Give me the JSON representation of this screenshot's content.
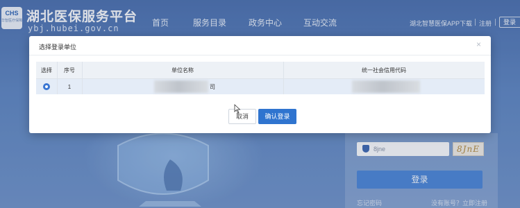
{
  "header": {
    "logo_text": "CHS",
    "logo_sub": "华智医疗保障",
    "site_title": "湖北医保服务平台",
    "site_domain": "ybj.hubei.gov.cn",
    "nav": [
      "首页",
      "服务目录",
      "政务中心",
      "互动交流"
    ],
    "app_download": "湖北智慧医保APP下载",
    "register": "注册",
    "login": "登录"
  },
  "login_form": {
    "captcha_value": "8jne",
    "captcha_image_text": "8JnE",
    "login_button": "登录",
    "forgot_password": "忘记密码",
    "register_prompt": "没有账号？立即注册"
  },
  "modal": {
    "title": "选择登录单位",
    "close_icon": "close-icon",
    "columns": [
      "选择",
      "序号",
      "单位名称",
      "统一社会信用代码"
    ],
    "rows": [
      {
        "selected": true,
        "index": "1",
        "unit_name_suffix": "司",
        "credit_code": ""
      }
    ],
    "cancel_button": "取消",
    "confirm_button": "确认登录"
  },
  "colors": {
    "primary": "#2f74cf",
    "selected_row": "#e4ecf7",
    "background": "#5e86c2"
  }
}
